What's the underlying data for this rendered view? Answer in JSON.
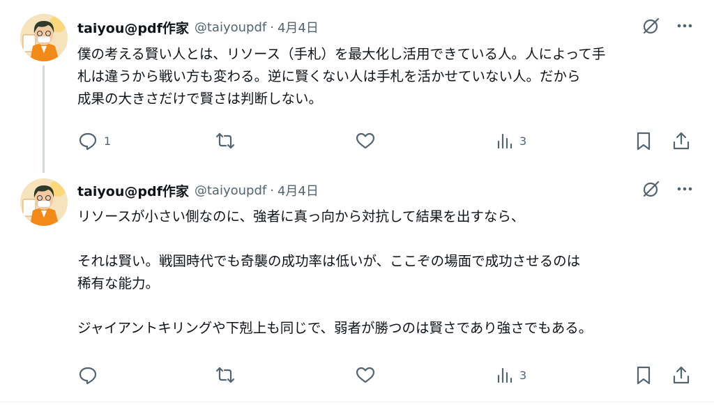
{
  "tweets": [
    {
      "author": {
        "display_name": "taiyou@pdf作家",
        "handle": "@taiyoupdf"
      },
      "separator": "·",
      "date": "4月4日",
      "text_lines": [
        "僕の考える賢い人とは、リソース（手札）を最大化し活用できている人。人によって手",
        "札は違うから戦い方も変わる。逆に賢くない人は手札を活かせていない人。だから",
        "成果の大きさだけで賢さは判断しない。"
      ],
      "stats": {
        "replies": "1",
        "retweets": "",
        "likes": "",
        "views": "3"
      },
      "icons": {
        "grok": "slashed-circle-icon",
        "more": "more-icon",
        "reply": "reply-icon",
        "retweet": "retweet-icon",
        "like": "heart-icon",
        "views": "views-icon",
        "bookmark": "bookmark-icon",
        "share": "share-icon"
      }
    },
    {
      "author": {
        "display_name": "taiyou@pdf作家",
        "handle": "@taiyoupdf"
      },
      "separator": "·",
      "date": "4月4日",
      "paragraphs": [
        [
          "リソースが小さい側なのに、強者に真っ向から対抗して結果を出すなら、"
        ],
        [
          "それは賢い。戦国時代でも奇襲の成功率は低いが、ここぞの場面で成功させるのは",
          "稀有な能力。"
        ],
        [
          "ジャイアントキリングや下剋上も同じで、弱者が勝つのは賢さであり強さでもある。"
        ]
      ],
      "stats": {
        "replies": "",
        "retweets": "",
        "likes": "",
        "views": "3"
      }
    }
  ],
  "colors": {
    "text": "#0f1419",
    "secondary": "#536471",
    "thread_line": "#cfd9de",
    "avatar_jacket": "#f28a1a"
  }
}
